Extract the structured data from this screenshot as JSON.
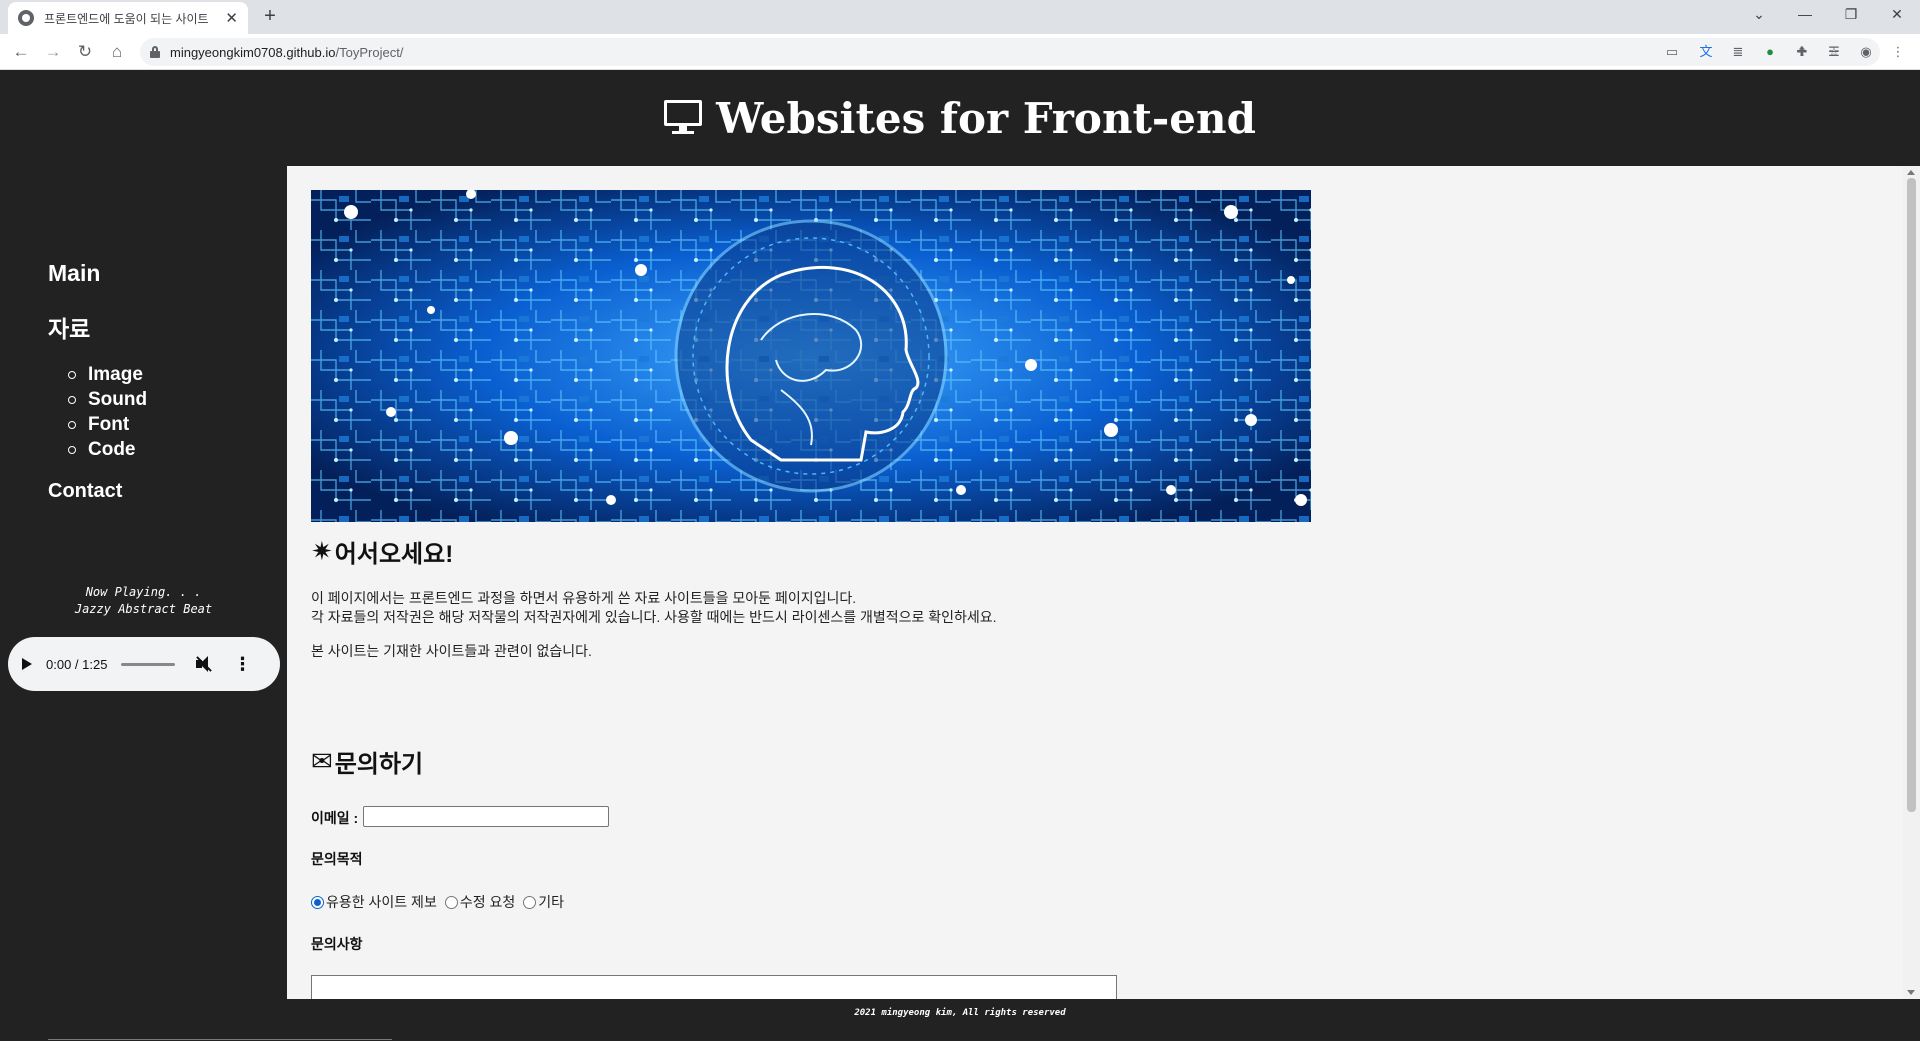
{
  "browser": {
    "tab_title": "프론트엔드에 도움이 되는 사이트",
    "tab_close": "✕",
    "new_tab": "+",
    "url_host": "mingyeongkim0708.github.io",
    "url_path": "/ToyProject/",
    "icons": [
      "back-icon",
      "forward-icon",
      "reload-icon",
      "home-icon",
      "lock-icon",
      "share-icon",
      "bookmark-star-icon",
      "extensions-icon",
      "profile-icon",
      "menu-icon"
    ]
  },
  "site": {
    "title": "Websites for Front-end"
  },
  "sidebar": {
    "main": "Main",
    "resources": "자료",
    "sub_items": [
      {
        "label": "Image"
      },
      {
        "label": "Sound"
      },
      {
        "label": "Font"
      },
      {
        "label": "Code"
      }
    ],
    "contact": "Contact",
    "now_playing_1": "Now Playing. . .",
    "now_playing_2": "Jazzy Abstract Beat",
    "player_time": "0:00 / 1:25"
  },
  "content": {
    "welcome_heading": "어서오세요!",
    "intro_line_1": "이 페이지에서는 프론트엔드 과정을 하면서 유용하게 쓴 자료 사이트들을 모아둔 페이지입니다.",
    "intro_line_2": "각 자료들의 저작권은 해당 저작물의 저작권자에게 있습니다. 사용할 때에는 반드시 라이센스를 개별적으로 확인하세요.",
    "disclaimer": "본 사이트는 기재한 사이트들과 관련이 없습니다.",
    "inquiry_heading": "문의하기",
    "email_label": "이메일 :",
    "email_value": "",
    "purpose_label": "문의목적",
    "purpose_options": [
      {
        "label": "유용한 사이트 제보",
        "checked": true
      },
      {
        "label": "수정 요청",
        "checked": false
      },
      {
        "label": "기타",
        "checked": false
      }
    ],
    "details_label": "문의사항"
  },
  "footer": {
    "text": "2021 mingyeong kim, All rights reserved"
  },
  "colors": {
    "page_bg": "#222222",
    "content_bg": "#f4f4f4",
    "hero_blue": "#0a5fd0",
    "radio_accent": "#0b63c9"
  }
}
